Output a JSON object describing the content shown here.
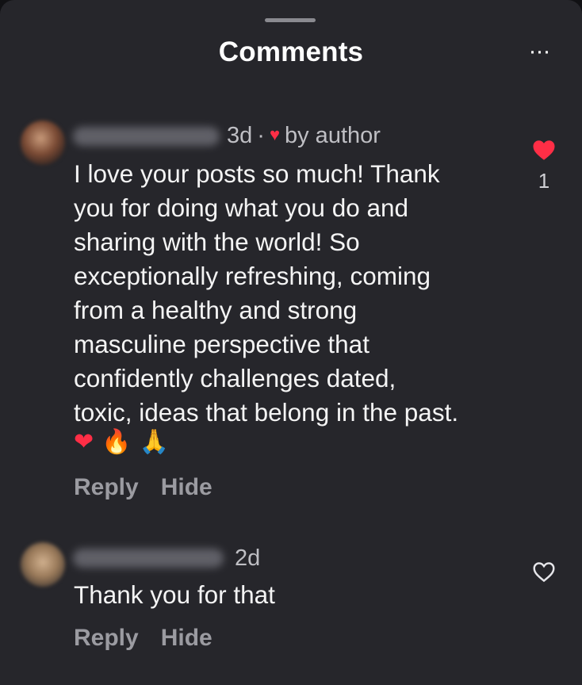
{
  "header": {
    "title": "Comments",
    "more_label": "···"
  },
  "comments": [
    {
      "time": "3d",
      "separator": "·",
      "liked_by_author": true,
      "liked_label": "by author",
      "text_lines": [
        "I love your posts so much! Thank",
        "you for doing what you do and",
        "sharing with the world! So",
        "exceptionally refreshing, coming",
        "from a healthy and strong",
        "masculine perspective that",
        "confidently challenges dated,",
        "toxic, ideas that belong in the past."
      ],
      "emojis": [
        "❤",
        "🔥",
        "🙏"
      ],
      "reply_label": "Reply",
      "hide_label": "Hide",
      "liked": true,
      "like_count": "1"
    },
    {
      "time": "2d",
      "text_lines": [
        "Thank you for that"
      ],
      "reply_label": "Reply",
      "hide_label": "Hide",
      "liked": false
    }
  ],
  "colors": {
    "background": "#26262b",
    "like_red": "#ff2e46",
    "muted_text": "#9b9ba1"
  }
}
